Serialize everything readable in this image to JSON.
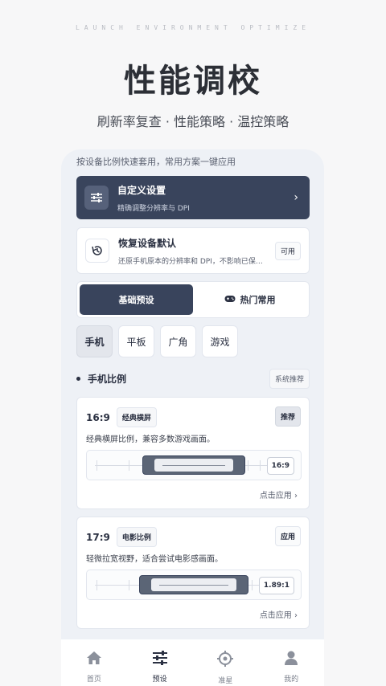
{
  "header": {
    "tagline": "LAUNCH ENVIRONMENT OPTIMIZE",
    "title": "性能调校",
    "subtitle": "刷新率复查 · 性能策略 · 温控策略"
  },
  "hint": "按设备比例快速套用，常用方案一键应用",
  "custom_card": {
    "title": "自定义设置",
    "desc": "精确调整分辨率与 DPI",
    "icon": "sliders-icon"
  },
  "restore_card": {
    "title": "恢复设备默认",
    "desc": "还原手机原本的分辨率和 DPI，不影响已保…",
    "badge": "可用",
    "icon": "history-icon"
  },
  "tabs": [
    {
      "label": "基础预设",
      "active": true
    },
    {
      "label": "热门常用",
      "active": false,
      "icon": "gamepad-icon"
    }
  ],
  "chips": [
    {
      "label": "手机",
      "active": true
    },
    {
      "label": "平板",
      "active": false
    },
    {
      "label": "广角",
      "active": false
    },
    {
      "label": "游戏",
      "active": false
    }
  ],
  "section": {
    "title": "手机比例",
    "badge": "系统推荐"
  },
  "ratio_cards": [
    {
      "ratio": "16:9",
      "tag": "经典横屏",
      "right": "推荐",
      "desc": "经典横屏比例，兼容多数游戏画面。",
      "value": "16:9",
      "apply": "点击应用 ›"
    },
    {
      "ratio": "17:9",
      "tag": "电影比例",
      "right": "应用",
      "desc": "轻微拉宽视野，适合尝试电影感画面。",
      "value": "1.89:1",
      "apply": "点击应用 ›"
    }
  ],
  "nav": [
    {
      "label": "首页",
      "icon": "home-icon",
      "active": false
    },
    {
      "label": "预设",
      "icon": "sliders-icon",
      "active": true
    },
    {
      "label": "准星",
      "icon": "crosshair-icon",
      "active": false
    },
    {
      "label": "我的",
      "icon": "user-icon",
      "active": false
    }
  ],
  "colors": {
    "accent": "#39445c",
    "background": "#f7f7f8",
    "panel": "#eef1f6"
  }
}
